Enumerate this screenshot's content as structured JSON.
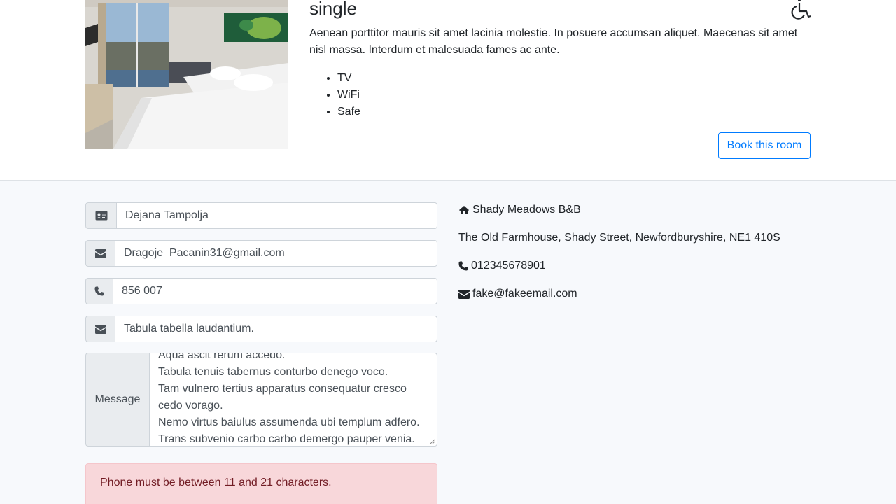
{
  "room": {
    "type": "single",
    "accessibility_icon": "wheelchair-icon",
    "description": "Aenean porttitor mauris sit amet lacinia molestie. In posuere accumsan aliquet. Maecenas sit amet nisl massa. Interdum et malesuada fames ac ante.",
    "features": [
      "TV",
      "WiFi",
      "Safe"
    ],
    "book_label": "Book this room"
  },
  "form": {
    "name": {
      "icon": "id-card-icon",
      "value": "Dejana Tampolja"
    },
    "email": {
      "icon": "envelope-icon",
      "value": "Dragoje_Pacanin31@gmail.com"
    },
    "phone": {
      "icon": "phone-icon",
      "value": "856 007"
    },
    "subject": {
      "icon": "envelope-icon",
      "value": "Tabula tabella laudantium."
    },
    "message": {
      "label": "Message",
      "lines": [
        "Aqua ascit rerum accedo.",
        "Tabula tenuis tabernus conturbo denego voco.",
        "Tam vulnero tertius apparatus consequatur cresco",
        "cedo vorago.",
        "Nemo virtus baiulus assumenda ubi templum adfero.",
        "Trans subvenio carbo carbo demergo pauper venia."
      ]
    },
    "error": "Phone must be between 11 and 21 characters."
  },
  "contact_info": {
    "name": "Shady Meadows B&B",
    "address": "The Old Farmhouse, Shady Street, Newfordburyshire, NE1 410S",
    "phone": "012345678901",
    "email": "fake@fakeemail.com"
  },
  "colors": {
    "primary": "#007bff",
    "alert_bg": "#f8d7da",
    "alert_text": "#721c24",
    "section_bg": "#f7f9fc"
  }
}
